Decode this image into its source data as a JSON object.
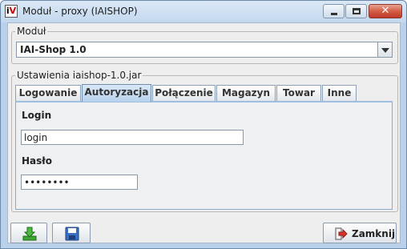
{
  "window": {
    "title": "Moduł - proxy (IAISHOP)",
    "app_icon_text": "iV",
    "close_glyph": "✕"
  },
  "modul": {
    "legend": "Moduł",
    "selected": "IAI-Shop 1.0"
  },
  "settings": {
    "legend": "Ustawienia iaishop-1.0.jar",
    "tabs": [
      {
        "label": "Logowanie"
      },
      {
        "label": "Autoryzacja"
      },
      {
        "label": "Połączenie"
      },
      {
        "label": "Magazyn"
      },
      {
        "label": "Towar"
      },
      {
        "label": "Inne"
      }
    ],
    "active_tab": "Autoryzacja",
    "login_label": "Login",
    "login_value": "login",
    "password_label": "Hasło",
    "password_value": "secret12"
  },
  "footer": {
    "close_label": "Zamknij"
  },
  "icons": {
    "download": "download-icon",
    "save": "save-icon",
    "exit": "exit-icon"
  },
  "colors": {
    "titlebar": "#c3d8ee",
    "active_tab": "#b8d2ec",
    "close_caption": "#c0392b",
    "download_green": "#3fa535",
    "save_blue": "#3b6fc4",
    "exit_red": "#d9342b"
  }
}
